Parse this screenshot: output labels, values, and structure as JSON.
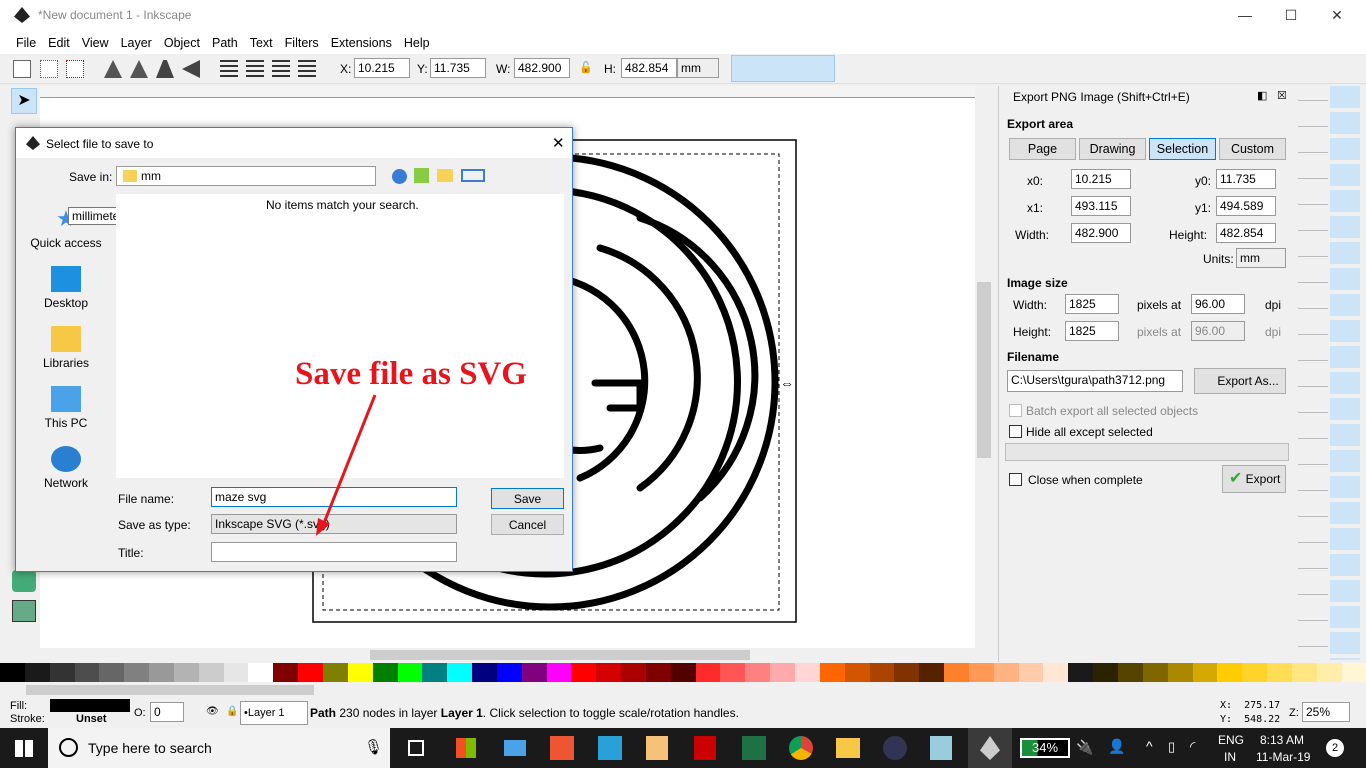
{
  "window": {
    "title": "*New document 1 - Inkscape",
    "minimize": "—",
    "maximize": "☐",
    "close": "✕"
  },
  "menu": [
    "File",
    "Edit",
    "View",
    "Layer",
    "Object",
    "Path",
    "Text",
    "Filters",
    "Extensions",
    "Help"
  ],
  "toolbar": {
    "x_label": "X:",
    "x": "10.215",
    "y_label": "Y:",
    "y": "11.735",
    "w_label": "W:",
    "w": "482.900",
    "h_label": "H:",
    "h": "482.854",
    "unit": "mm"
  },
  "dialog": {
    "title": "Select file to save to",
    "save_in_label": "Save in:",
    "save_in": "mm",
    "empty_msg": "No items match your search.",
    "tooltip": "millimeters",
    "places": [
      "Quick access",
      "Desktop",
      "Libraries",
      "This PC",
      "Network"
    ],
    "file_name_label": "File name:",
    "file_name": "maze svg",
    "save_type_label": "Save as type:",
    "save_type": "Inkscape SVG (*.svg)",
    "title_label": "Title:",
    "title_value": "",
    "save": "Save",
    "cancel": "Cancel"
  },
  "annotation": {
    "text": "Save file as SVG",
    "color": "#e8141c"
  },
  "export": {
    "title": "Export PNG Image (Shift+Ctrl+E)",
    "area_label": "Export area",
    "tabs": [
      "Page",
      "Drawing",
      "Selection",
      "Custom"
    ],
    "active_tab": "Selection",
    "x0_label": "x0:",
    "x0": "10.215",
    "y0_label": "y0:",
    "y0": "11.735",
    "x1_label": "x1:",
    "x1": "493.115",
    "y1_label": "y1:",
    "y1": "494.589",
    "width_label": "Width:",
    "width": "482.900",
    "height_label": "Height:",
    "height": "482.854",
    "units_label": "Units:",
    "units": "mm",
    "image_size_label": "Image size",
    "img_width_label": "Width:",
    "img_width": "1825",
    "img_height_label": "Height:",
    "img_height": "1825",
    "pixels_at": "pixels at",
    "dpi1": "96.00",
    "dpi2": "96.00",
    "dpi": "dpi",
    "filename_label": "Filename",
    "filename": "C:\\Users\\tgura\\path3712.png",
    "export_as": "Export As...",
    "batch": "Batch export all selected objects",
    "hide_all": "Hide all except selected",
    "close_when": "Close when complete",
    "export_btn": "Export"
  },
  "status": {
    "fill_label": "Fill:",
    "stroke_label": "Stroke:",
    "stroke": "Unset",
    "opacity_label": "O:",
    "opacity": "0",
    "layer": "•Layer 1",
    "msg_bold": "Path",
    "msg": " 230 nodes in layer ",
    "msg_layer": "Layer 1",
    "msg_end": ". Click selection to toggle scale/rotation handles.",
    "x": "X:  275.17",
    "y": "Y:  548.22",
    "zoom_label": "Z:",
    "zoom": "25%"
  },
  "taskbar": {
    "search": "Type here to search",
    "battery": "34%",
    "lang1": "ENG",
    "lang2": "IN",
    "time": "8:13 AM",
    "date": "11-Mar-19",
    "notif": "2"
  },
  "palette": [
    "#000000",
    "#1a1a1a",
    "#333",
    "#4d4d4d",
    "#666",
    "#808080",
    "#999",
    "#b3b3b3",
    "#ccc",
    "#e6e6e6",
    "#fff",
    "#800000",
    "#ff0000",
    "#808000",
    "#ffff00",
    "#008000",
    "#00ff00",
    "#008080",
    "#00ffff",
    "#000080",
    "#0000ff",
    "#800080",
    "#ff00ff",
    "#ff0000",
    "#d40000",
    "#aa0000",
    "#800000",
    "#550000",
    "#ff2a2a",
    "#ff5555",
    "#ff8080",
    "#ffaaaa",
    "#ffd5d5",
    "#ff6600",
    "#d45500",
    "#aa4400",
    "#803300",
    "#552200",
    "#ff7f2a",
    "#ff9955",
    "#ffb380",
    "#ffccaa",
    "#ffe6d5",
    "#1a1a1a",
    "#2b2200",
    "#554400",
    "#806600",
    "#aa8800",
    "#d4aa00",
    "#ffcc00",
    "#ffd42a",
    "#ffdd55",
    "#ffe680",
    "#ffeeaa",
    "#fff6d5"
  ]
}
